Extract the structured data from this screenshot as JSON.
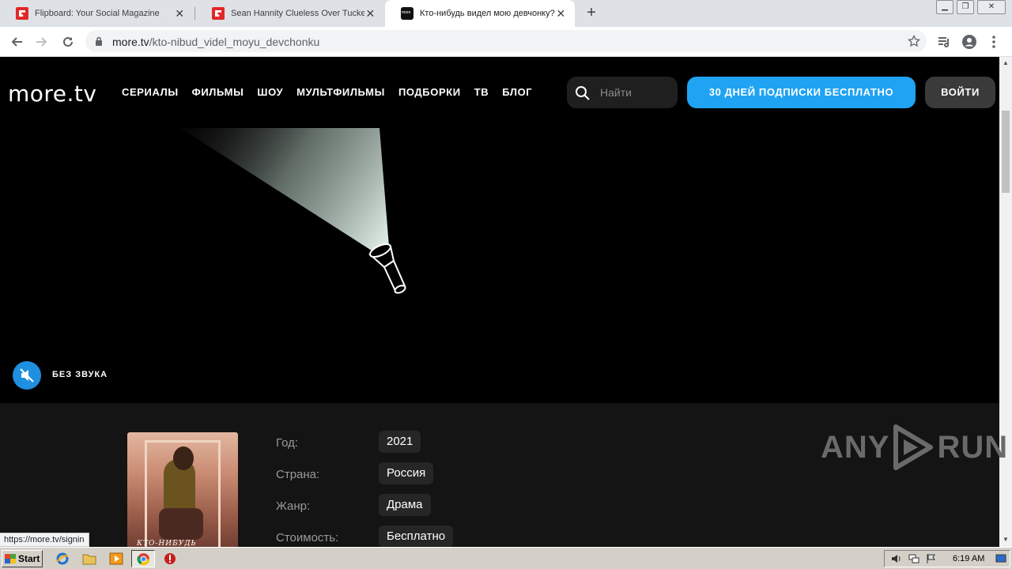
{
  "browser": {
    "tabs": [
      {
        "title": "Flipboard: Your Social Magazine",
        "favicon": "flipboard-icon",
        "active": false
      },
      {
        "title": "Sean Hannity Clueless Over Tucker C",
        "favicon": "flipboard-icon",
        "active": false
      },
      {
        "title": "Кто-нибудь видел мою девчонку?",
        "favicon": "more-tv-icon",
        "active": true
      }
    ],
    "url_host": "more.tv",
    "url_path": "/kto-nibud_videl_moyu_devchonku",
    "status_url": "https://more.tv/signin"
  },
  "site": {
    "logo": "more.tv",
    "menu": [
      "СЕРИАЛЫ",
      "ФИЛЬМЫ",
      "ШОУ",
      "МУЛЬТФИЛЬМЫ",
      "ПОДБОРКИ",
      "ТВ",
      "БЛОГ"
    ],
    "search_placeholder": "Найти",
    "subscribe_label": "30 ДНЕЙ ПОДПИСКИ БЕСПЛАТНО",
    "login_label": "ВОЙТИ",
    "mute_label": "БЕЗ ЗВУКА",
    "poster_title": "КТО-НИБУДЬ",
    "info": [
      {
        "label": "Год:",
        "value": "2021"
      },
      {
        "label": "Страна:",
        "value": "Россия"
      },
      {
        "label": "Жанр:",
        "value": "Драма"
      },
      {
        "label": "Стоимость:",
        "value": "Бесплатно"
      }
    ],
    "colors": {
      "accent": "#1fa3f2",
      "mute_button": "#1f8fe0",
      "background": "#000000",
      "details_bg": "#141414"
    }
  },
  "watermark": {
    "left": "ANY",
    "right": "RUN"
  },
  "taskbar": {
    "start_label": "Start",
    "clock": "6:19 AM"
  }
}
